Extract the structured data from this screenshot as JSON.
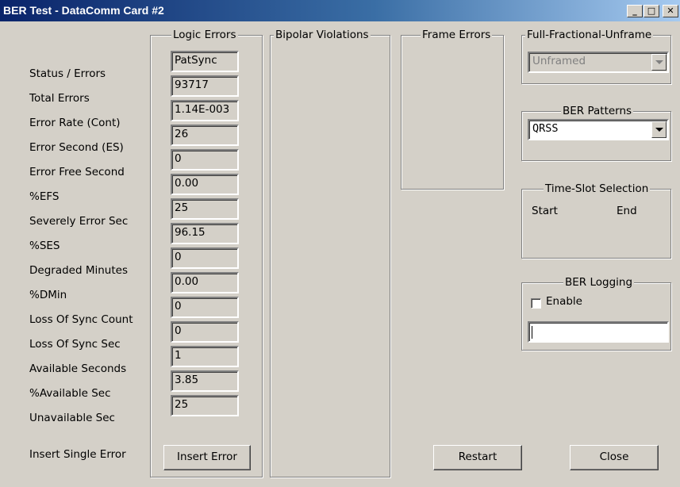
{
  "window": {
    "title": "BER Test - DataComm Card #2",
    "min_glyph": "_",
    "max_glyph": "□",
    "close_glyph": "✕"
  },
  "rows": [
    {
      "label": "Status / Errors",
      "value": "PatSync"
    },
    {
      "label": "Total Errors",
      "value": "93717"
    },
    {
      "label": "Error Rate (Cont)",
      "value": "1.14E-003"
    },
    {
      "label": "Error Second (ES)",
      "value": "26"
    },
    {
      "label": "Error Free Second",
      "value": "0"
    },
    {
      "label": "%EFS",
      "value": " 0.00"
    },
    {
      "label": "Severely Error Sec",
      "value": "25"
    },
    {
      "label": "%SES",
      "value": "96.15"
    },
    {
      "label": "Degraded Minutes",
      "value": "0"
    },
    {
      "label": "%DMin",
      "value": " 0.00"
    },
    {
      "label": "Loss Of Sync Count",
      "value": "0"
    },
    {
      "label": "Loss Of Sync Sec",
      "value": "0"
    },
    {
      "label": "Available Seconds",
      "value": "1"
    },
    {
      "label": "%Available Sec",
      "value": " 3.85"
    },
    {
      "label": "Unavailable Sec",
      "value": "25"
    }
  ],
  "insert_single_error_label": "Insert Single Error",
  "groups": {
    "logic_errors": "Logic Errors",
    "bipolar_violations": "Bipolar Violations",
    "frame_errors": "Frame Errors",
    "framing": "Full-Fractional-Unframe",
    "ber_patterns": "BER Patterns",
    "time_slot": "Time-Slot Selection",
    "ber_logging": "BER Logging"
  },
  "framing_select": {
    "value": "Unframed",
    "enabled": false
  },
  "pattern_select": {
    "value": "QRSS"
  },
  "time_slot": {
    "start_label": "Start",
    "end_label": "End"
  },
  "logging": {
    "enable_label": "Enable",
    "enabled": false,
    "filename": ""
  },
  "buttons": {
    "insert_error": "Insert Error",
    "restart": "Restart",
    "close": "Close"
  }
}
